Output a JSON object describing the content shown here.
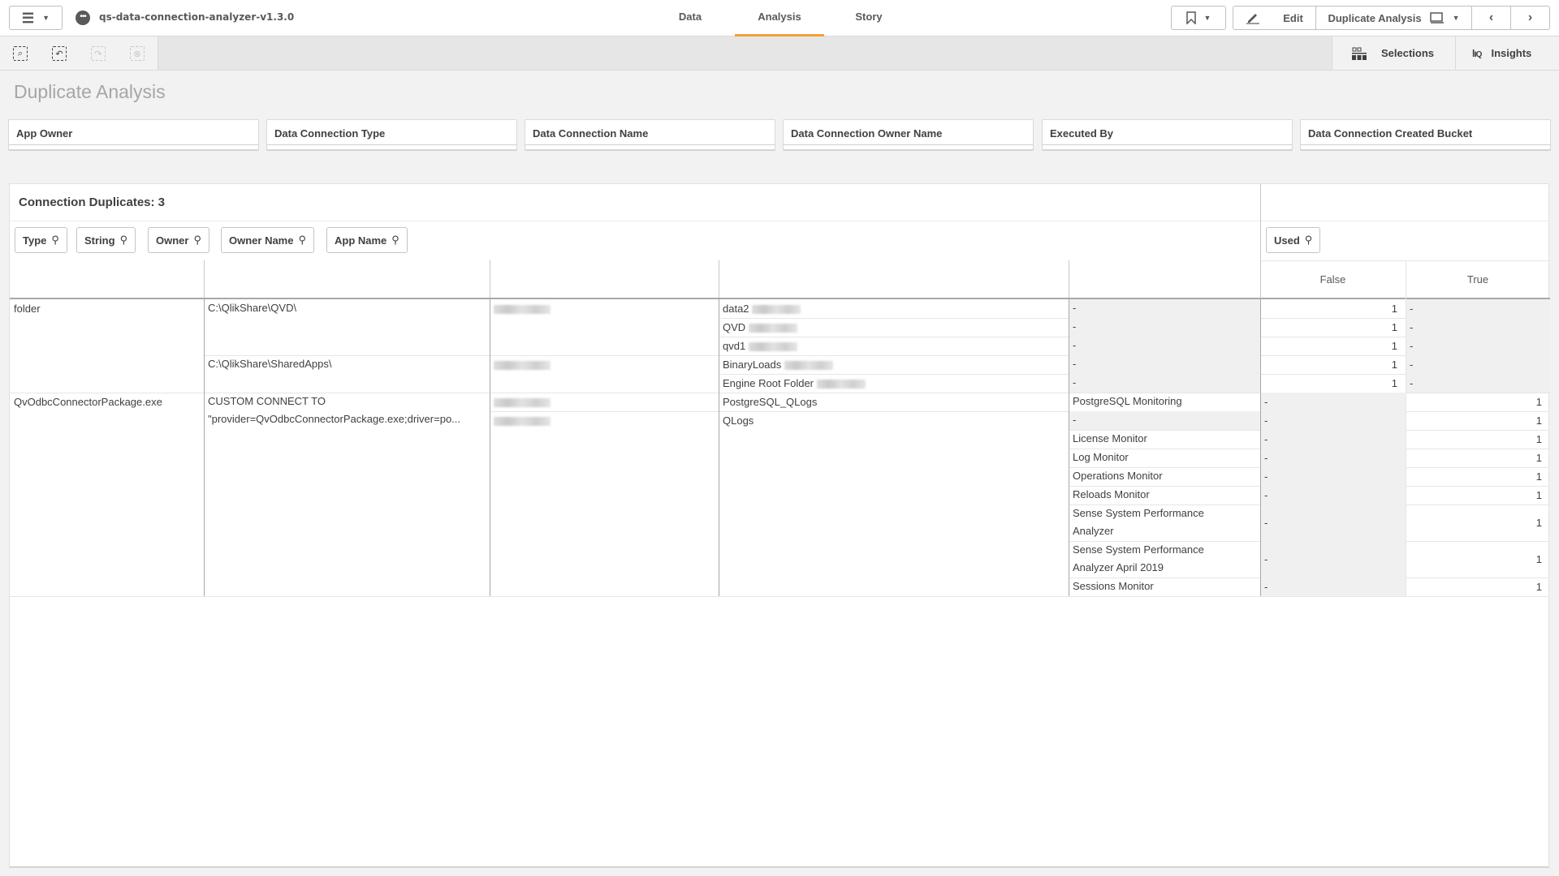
{
  "header": {
    "app_title": "qs-data-connection-analyzer-v1.3.0",
    "tabs": [
      {
        "label": "Data",
        "active": false
      },
      {
        "label": "Analysis",
        "active": true
      },
      {
        "label": "Story",
        "active": false
      }
    ],
    "edit_label": "Edit",
    "sheet_selector_label": "Duplicate Analysis",
    "accent_color": "#f2a03d"
  },
  "toolbar": {
    "tools": [
      "smart-search",
      "step-back",
      "step-forward",
      "clear-selections"
    ],
    "selections_label": "Selections",
    "insights_label": "Insights"
  },
  "sheet": {
    "title": "Duplicate Analysis",
    "filters": [
      "App Owner",
      "Data Connection Type",
      "Data Connection Name",
      "Data Connection Owner Name",
      "Executed By",
      "Data Connection Created Bucket"
    ]
  },
  "table": {
    "title": "Connection Duplicates: 3",
    "dimension_chips": [
      "Type",
      "String",
      "Owner",
      "Owner Name",
      "App Name"
    ],
    "pivot_chip": "Used",
    "pivot_columns": [
      "False",
      "True"
    ],
    "groups": [
      {
        "type": "folder",
        "strings": [
          {
            "string": "C:\\QlikShare\\QVD\\",
            "owner": "[blurred]",
            "names": [
              {
                "name": "data2",
                "blurred_suffix": true,
                "apps": [
                  {
                    "app": "-",
                    "false": "1",
                    "true": "-"
                  }
                ]
              },
              {
                "name": "QVD",
                "blurred_suffix": true,
                "apps": [
                  {
                    "app": "-",
                    "false": "1",
                    "true": "-"
                  }
                ]
              },
              {
                "name": "qvd1",
                "blurred_suffix": true,
                "apps": [
                  {
                    "app": "-",
                    "false": "1",
                    "true": "-"
                  }
                ]
              }
            ]
          },
          {
            "string": "C:\\QlikShare\\SharedApps\\",
            "owner": "[blurred]",
            "names": [
              {
                "name": "BinaryLoads",
                "blurred_suffix": true,
                "apps": [
                  {
                    "app": "-",
                    "false": "1",
                    "true": "-"
                  }
                ]
              },
              {
                "name": "Engine Root Folder",
                "blurred_suffix": true,
                "apps": [
                  {
                    "app": "-",
                    "false": "1",
                    "true": "-"
                  }
                ]
              }
            ]
          }
        ]
      },
      {
        "type": "QvOdbcConnectorPackage.exe",
        "strings": [
          {
            "string": "CUSTOM CONNECT TO",
            "string_line2": "\"provider=QvOdbcConnectorPackage.exe;driver=po...",
            "owner": "[blurred]",
            "owner2": "[blurred]",
            "names": [
              {
                "name": "PostgreSQL_QLogs",
                "apps": [
                  {
                    "app": "PostgreSQL Monitoring",
                    "false": "-",
                    "true": "1"
                  }
                ]
              },
              {
                "name": "QLogs",
                "apps": [
                  {
                    "app": "-",
                    "false": "-",
                    "true": "1"
                  },
                  {
                    "app": "License Monitor",
                    "false": "-",
                    "true": "1"
                  },
                  {
                    "app": "Log Monitor",
                    "false": "-",
                    "true": "1"
                  },
                  {
                    "app": "Operations Monitor",
                    "false": "-",
                    "true": "1"
                  },
                  {
                    "app": "Reloads Monitor",
                    "false": "-",
                    "true": "1"
                  },
                  {
                    "app": "Sense System Performance Analyzer",
                    "false": "-",
                    "true": "1"
                  },
                  {
                    "app": "Sense System Performance Analyzer April 2019",
                    "false": "-",
                    "true": "1"
                  },
                  {
                    "app": "Sessions Monitor",
                    "false": "-",
                    "true": "1"
                  }
                ]
              }
            ]
          }
        ]
      }
    ]
  }
}
